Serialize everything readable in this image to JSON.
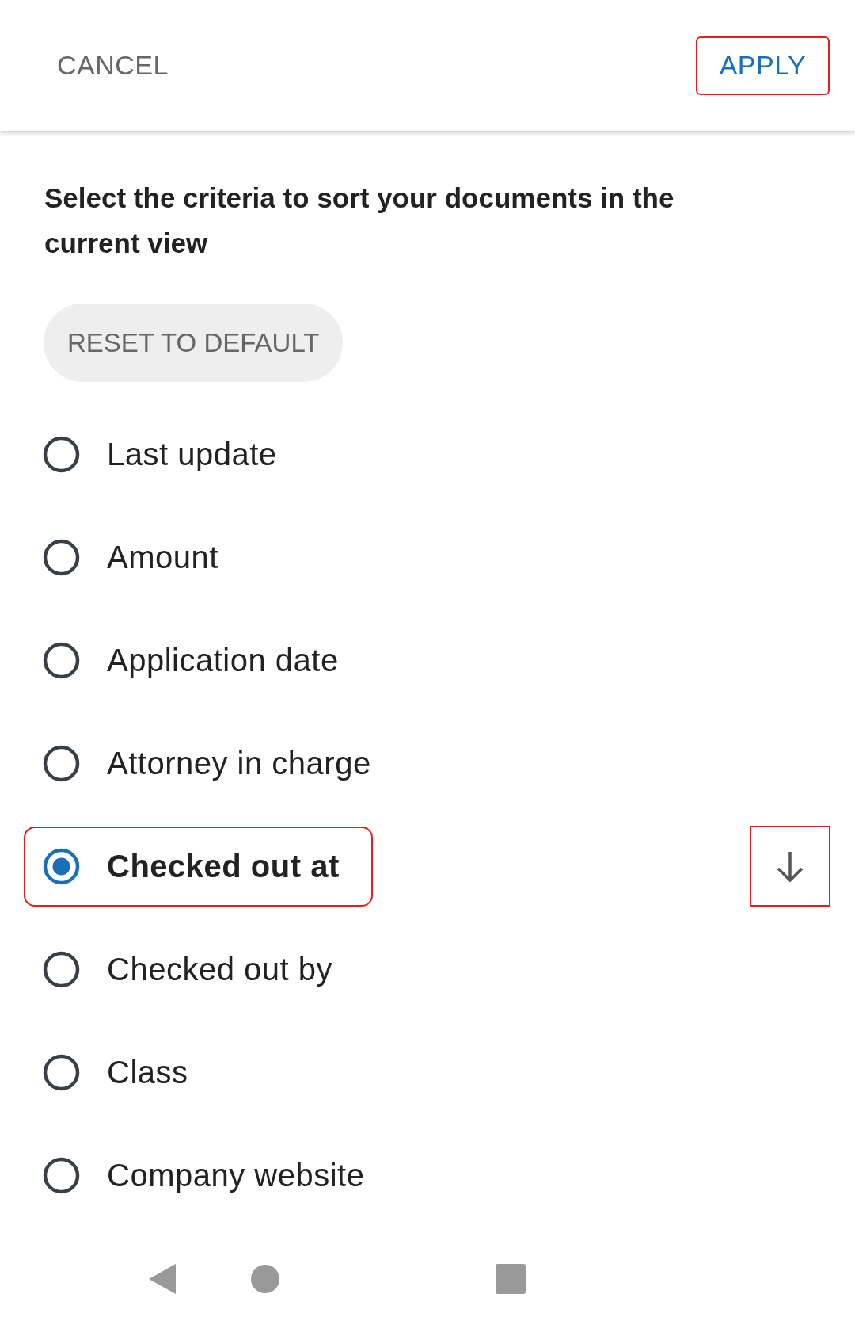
{
  "header": {
    "cancel": "CANCEL",
    "apply": "APPLY"
  },
  "description": "Select the criteria to sort your documents in the current view",
  "reset_button": "RESET TO DEFAULT",
  "options": [
    {
      "label": "Last update",
      "selected": false
    },
    {
      "label": "Amount",
      "selected": false
    },
    {
      "label": "Application date",
      "selected": false
    },
    {
      "label": "Attorney in charge",
      "selected": false
    },
    {
      "label": "Checked out at",
      "selected": true
    },
    {
      "label": "Checked out by",
      "selected": false
    },
    {
      "label": "Class",
      "selected": false
    },
    {
      "label": "Company website",
      "selected": false
    }
  ]
}
